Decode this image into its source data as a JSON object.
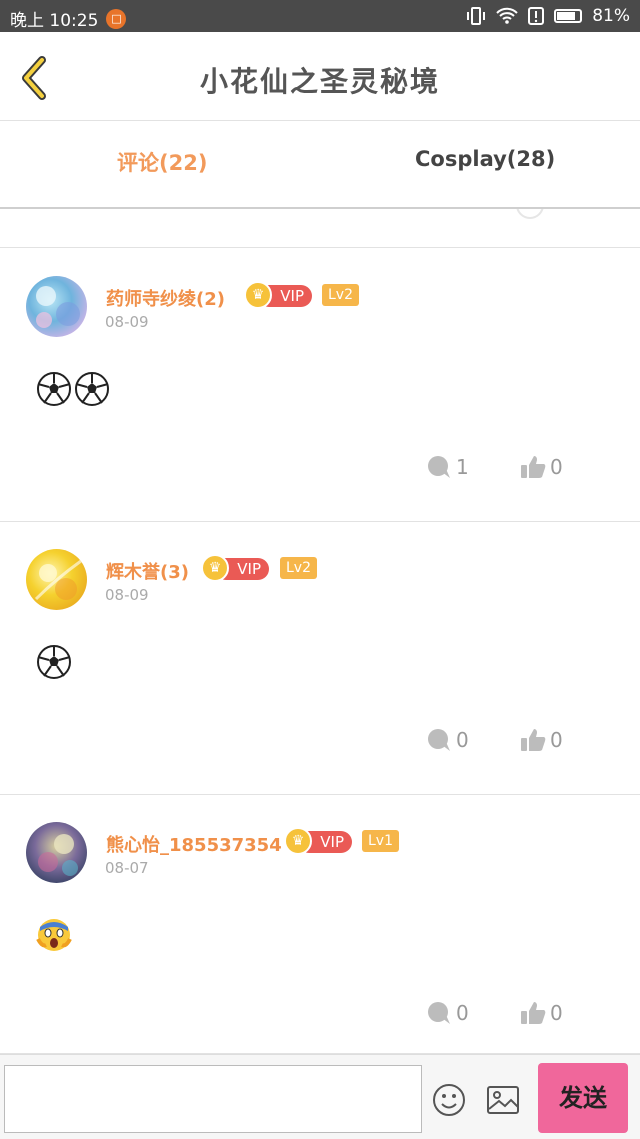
{
  "status_bar": {
    "time": "晚上 10:25",
    "battery": "81%",
    "battery_level": 0.81
  },
  "header": {
    "title": "小花仙之圣灵秘境"
  },
  "tabs": [
    {
      "label": "评论(22)",
      "active": true
    },
    {
      "label": "Cosplay(28)",
      "active": false
    }
  ],
  "comments": [
    {
      "username": "药师寺纱绫(2)",
      "vip": "VIP",
      "level": "Lv2",
      "date": "08-09",
      "content_emojis": [
        "soccer-ball",
        "soccer-ball"
      ],
      "reply_count": "1",
      "like_count": "0"
    },
    {
      "username": "辉木誉(3)",
      "vip": "VIP",
      "level": "Lv2",
      "date": "08-09",
      "content_emojis": [
        "soccer-ball"
      ],
      "reply_count": "0",
      "like_count": "0"
    },
    {
      "username": "熊心怡_185537354",
      "vip": "VIP",
      "level": "Lv1",
      "date": "08-07",
      "content_emojis": [
        "screaming-face"
      ],
      "reply_count": "0",
      "like_count": "0"
    }
  ],
  "bottom_bar": {
    "send_label": "发送",
    "input_placeholder": ""
  },
  "colors": {
    "accent_orange": "#f0904a",
    "vip_red": "#ea5a55",
    "level_gold": "#f6b64a",
    "send_pink": "#f0679b",
    "status_bar": "#4a4a4a"
  },
  "icons": {
    "back": "chevron-left-icon",
    "reply": "speech-bubble-icon",
    "like": "thumbs-up-icon",
    "emoji": "smiley-icon",
    "image": "image-icon",
    "vip": "crown-icon"
  }
}
